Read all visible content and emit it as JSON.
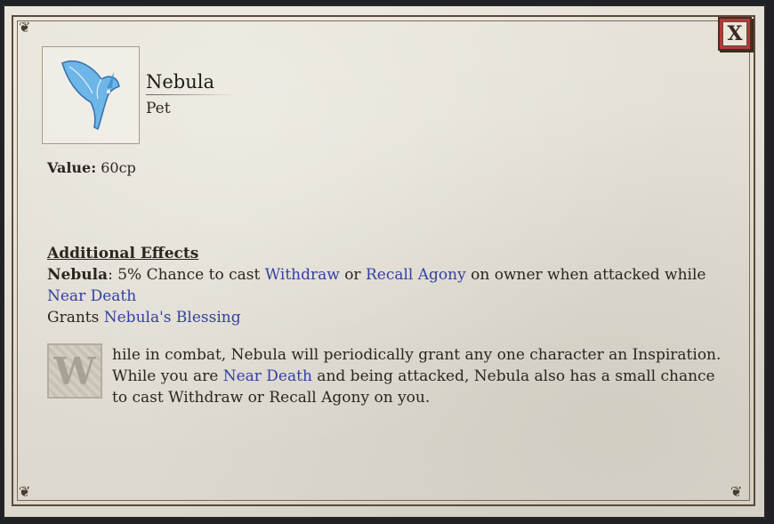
{
  "close_button": {
    "label": "X",
    "icon": "close-icon"
  },
  "item": {
    "name": "Nebula",
    "type": "Pet",
    "icon": "nebula-pet-icon"
  },
  "value": {
    "label": "Value:",
    "amount": "60cp"
  },
  "effects": {
    "heading": "Additional Effects",
    "line1": {
      "source": "Nebula",
      "text_a": ": 5% Chance to cast ",
      "link_withdraw": "Withdraw",
      "text_b": " or ",
      "link_recall": "Recall Agony",
      "text_c": " on owner when attacked while ",
      "link_near_death": "Near Death"
    },
    "line2": {
      "text": "Grants ",
      "link_blessing": "Nebula's Blessing"
    }
  },
  "lore": {
    "drop_cap": "W",
    "text_a": "hile in combat, Nebula will periodically grant any one character an Inspiration. While you are ",
    "link_near_death": "Near Death",
    "text_b": " and being attacked, Nebula also has a small chance to cast Withdraw or Recall Agony on you."
  },
  "colors": {
    "link": "#3440a0",
    "parchment": "#e2ded4",
    "close_red": "#b33a3a"
  }
}
